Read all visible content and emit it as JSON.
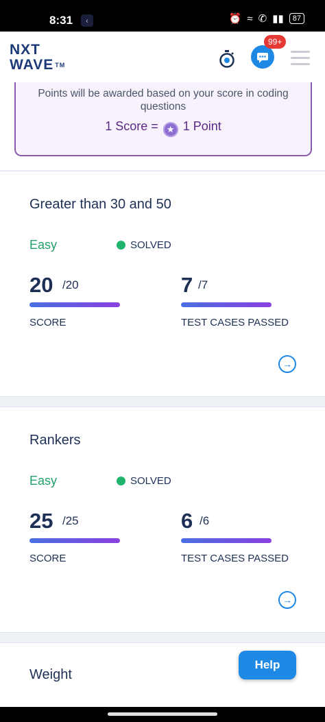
{
  "status_bar": {
    "time": "8:31",
    "app_icon": "back-arrow-icon",
    "battery": "87"
  },
  "header": {
    "logo_line1": "NXT",
    "logo_line2": "WAVE",
    "logo_tm": "TM",
    "timer_icon": "stopwatch-icon",
    "chat_icon": "chat-icon",
    "notification_badge": "99+",
    "menu_icon": "hamburger-menu-icon"
  },
  "points_info": {
    "description": "Points will be awarded based on your score in coding questions",
    "formula_left": "1 Score =",
    "formula_right": "1 Point"
  },
  "problems": [
    {
      "title": "Greater than 30 and 50",
      "difficulty": "Easy",
      "status": "SOLVED",
      "score": {
        "value": "20",
        "total": "/20",
        "label": "SCORE",
        "progress": 1.0
      },
      "test_cases": {
        "value": "7",
        "total": "/7",
        "label": "TEST CASES PASSED",
        "progress": 1.0
      }
    },
    {
      "title": "Rankers",
      "difficulty": "Easy",
      "status": "SOLVED",
      "score": {
        "value": "25",
        "total": "/25",
        "label": "SCORE",
        "progress": 1.0
      },
      "test_cases": {
        "value": "6",
        "total": "/6",
        "label": "TEST CASES PASSED",
        "progress": 1.0
      }
    },
    {
      "title": "Weight"
    }
  ],
  "help_button": {
    "label": "Help"
  },
  "colors": {
    "accent": "#1e88e5",
    "easy": "#22a06b",
    "solved_dot": "#1fb56d",
    "primary_text": "#1e2f55",
    "border_purple": "#8a5bb0"
  }
}
